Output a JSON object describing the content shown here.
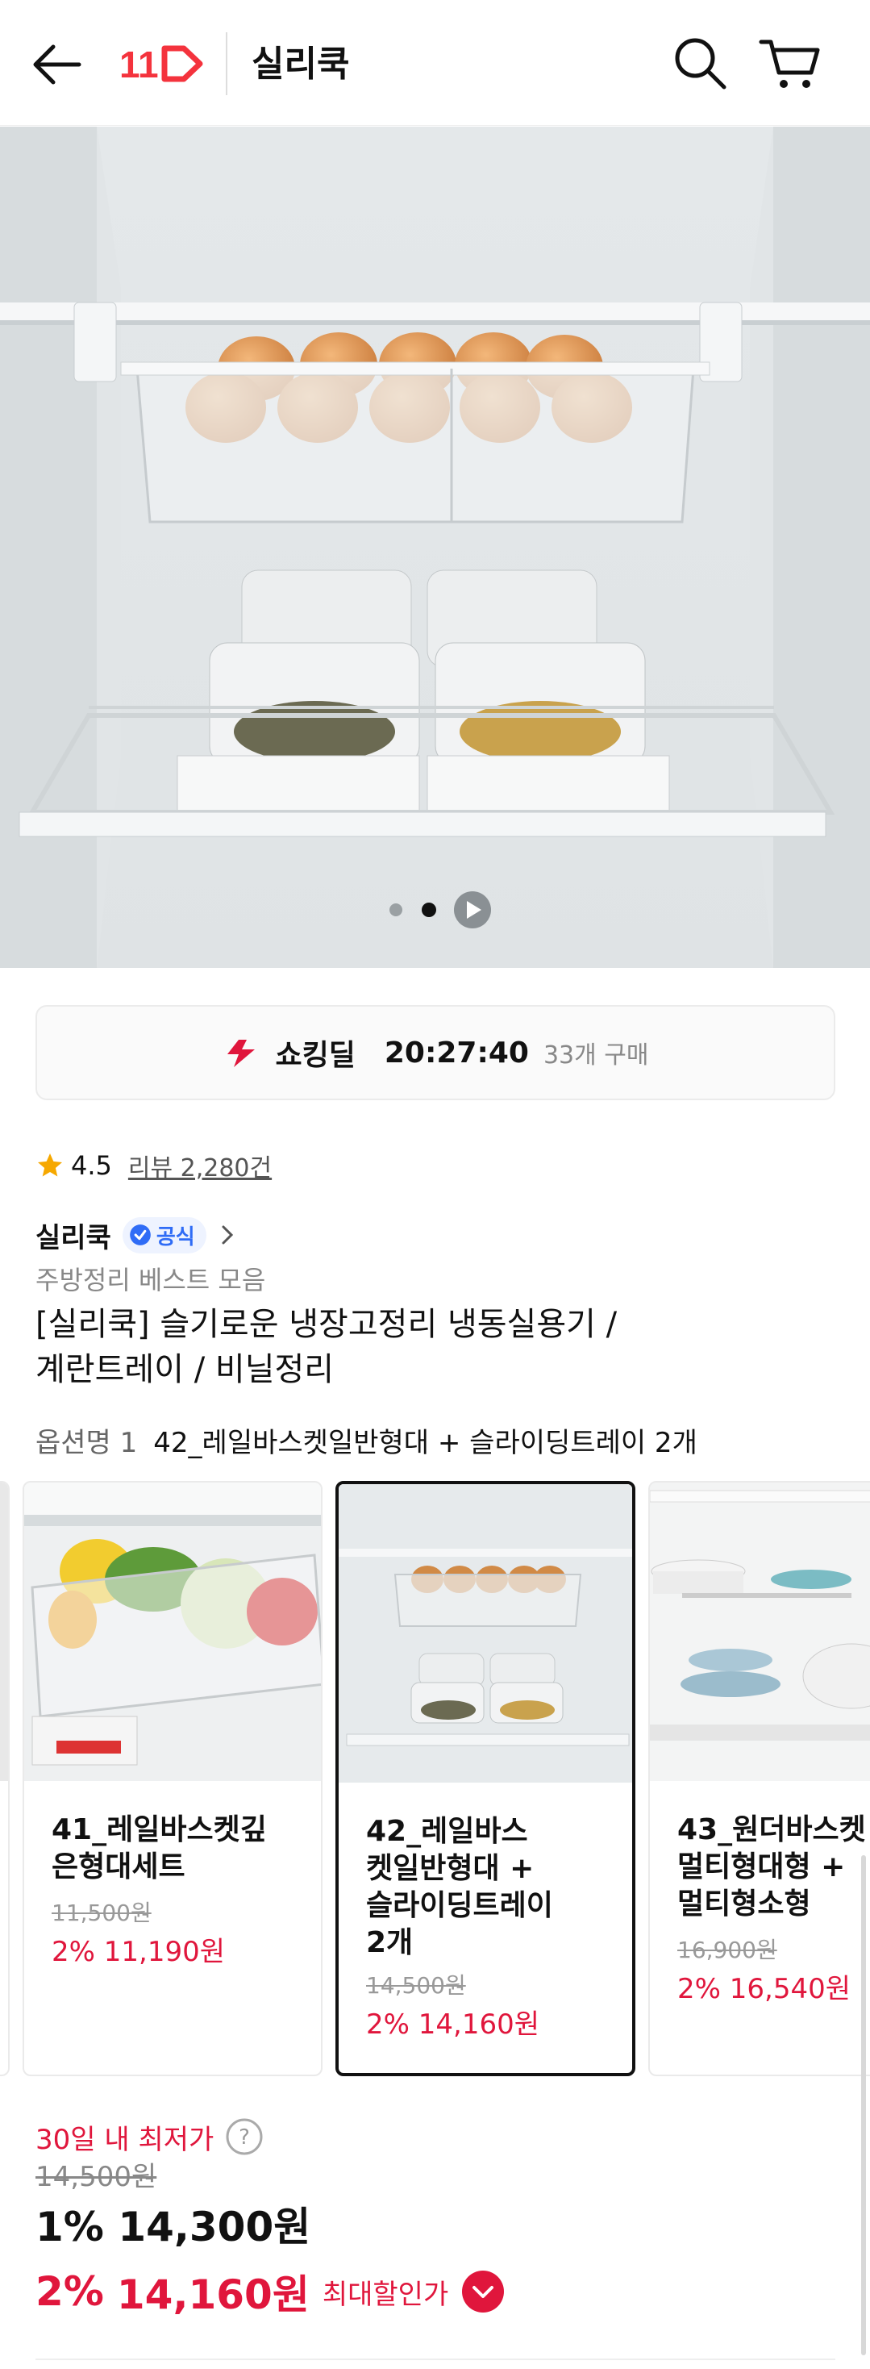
{
  "header": {
    "title": "실리쿡",
    "logo_text": "11",
    "icons": [
      "back-arrow-icon",
      "search-icon",
      "cart-icon"
    ],
    "logo_color": "#f4333d"
  },
  "hero": {
    "slide_count": 2,
    "active_slide": 2
  },
  "deal": {
    "label": "쇼킹딜",
    "timer": "20:27:40",
    "buyers": "33개 구매"
  },
  "rating": {
    "score": "4.5",
    "reviews": "리뷰 2,280건"
  },
  "seller": {
    "name": "실리쿡",
    "badge": "공식",
    "subcategory": "주방정리 베스트 모음"
  },
  "product": {
    "title_line1": "[실리쿡] 슬기로운 냉장고정리 냉동실용기 /",
    "title_line2": "계란트레이 / 비닐정리",
    "option_label": "옵션명 1",
    "option_value": "42_레일바스켓일반형대 + 슬라이딩트레이 2개"
  },
  "options": [
    {
      "name_lines": [
        "41_레일바스켓깊",
        "은형대세트"
      ],
      "original": "11,500원",
      "price": "2% 11,190원",
      "selected": false
    },
    {
      "name_lines": [
        "42_레일바스",
        "켓일반형대 +",
        "슬라이딩트레이",
        "2개"
      ],
      "original": "14,500원",
      "price": "2% 14,160원",
      "selected": true
    },
    {
      "name_lines": [
        "43_원더바스켓",
        "멀티형대형 +",
        "멀티형소형"
      ],
      "original": "16,900원",
      "price": "2% 16,540원",
      "selected": false
    }
  ],
  "pricing": {
    "lowest_label": "30일 내 최저가",
    "original": "14,500원",
    "price1_pct": "1%",
    "price1": "14,300원",
    "price2_pct": "2%",
    "price2": "14,160원",
    "max_discount": "최대할인가"
  },
  "colors": {
    "accent": "#e0163c",
    "official_blue": "#2f6cf6"
  }
}
